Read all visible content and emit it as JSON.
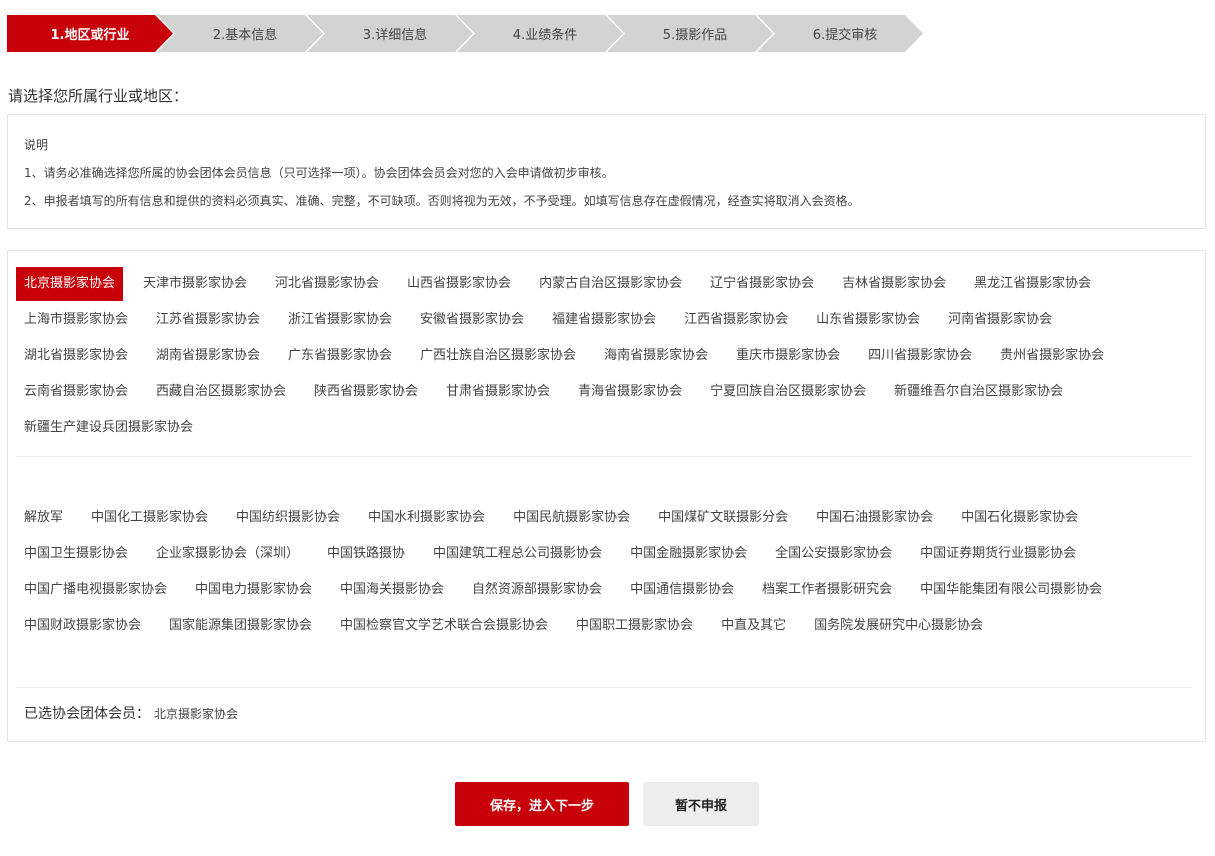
{
  "steps": [
    {
      "label": "1.地区或行业",
      "active": true
    },
    {
      "label": "2.基本信息",
      "active": false
    },
    {
      "label": "3.详细信息",
      "active": false
    },
    {
      "label": "4.业绩条件",
      "active": false
    },
    {
      "label": "5.摄影作品",
      "active": false
    },
    {
      "label": "6.提交审核",
      "active": false
    }
  ],
  "prompt": "请选择您所属行业或地区：",
  "notice": {
    "title": "说明",
    "line1": "1、请务必准确选择您所属的协会团体会员信息（只可选择一项）。协会团体会员会对您的入会申请做初步审核。",
    "line2": "2、申报者填写的所有信息和提供的资料必须真实、准确、完整，不可缺项。否则将视为无效，不予受理。如填写信息存在虚假情况，经查实将取消入会资格。"
  },
  "regions": [
    "北京摄影家协会",
    "天津市摄影家协会",
    "河北省摄影家协会",
    "山西省摄影家协会",
    "内蒙古自治区摄影家协会",
    "辽宁省摄影家协会",
    "吉林省摄影家协会",
    "黑龙江省摄影家协会",
    "上海市摄影家协会",
    "江苏省摄影家协会",
    "浙江省摄影家协会",
    "安徽省摄影家协会",
    "福建省摄影家协会",
    "江西省摄影家协会",
    "山东省摄影家协会",
    "河南省摄影家协会",
    "湖北省摄影家协会",
    "湖南省摄影家协会",
    "广东省摄影家协会",
    "广西壮族自治区摄影家协会",
    "海南省摄影家协会",
    "重庆市摄影家协会",
    "四川省摄影家协会",
    "贵州省摄影家协会",
    "云南省摄影家协会",
    "西藏自治区摄影家协会",
    "陕西省摄影家协会",
    "甘肃省摄影家协会",
    "青海省摄影家协会",
    "宁夏回族自治区摄影家协会",
    "新疆维吾尔自治区摄影家协会",
    "新疆生产建设兵团摄影家协会"
  ],
  "industries": [
    "解放军",
    "中国化工摄影家协会",
    "中国纺织摄影协会",
    "中国水利摄影家协会",
    "中国民航摄影家协会",
    "中国煤矿文联摄影分会",
    "中国石油摄影家协会",
    "中国石化摄影家协会",
    "中国卫生摄影协会",
    "企业家摄影协会（深圳）",
    "中国铁路摄协",
    "中国建筑工程总公司摄影协会",
    "中国金融摄影家协会",
    "全国公安摄影家协会",
    "中国证券期货行业摄影协会",
    "中国广播电视摄影家协会",
    "中国电力摄影家协会",
    "中国海关摄影协会",
    "自然资源部摄影家协会",
    "中国通信摄影协会",
    "档案工作者摄影研究会",
    "中国华能集团有限公司摄影协会",
    "中国财政摄影家协会",
    "国家能源集团摄影家协会",
    "中国检察官文学艺术联合会摄影协会",
    "中国职工摄影家协会",
    "中直及其它",
    "国务院发展研究中心摄影协会"
  ],
  "selected": {
    "label": "已选协会团体会员：",
    "value": "北京摄影家协会"
  },
  "buttons": {
    "save": "保存，进入下一步",
    "skip": "暂不申报"
  },
  "colors": {
    "accent": "#c8000a",
    "step_inactive": "#d3d3d3"
  }
}
